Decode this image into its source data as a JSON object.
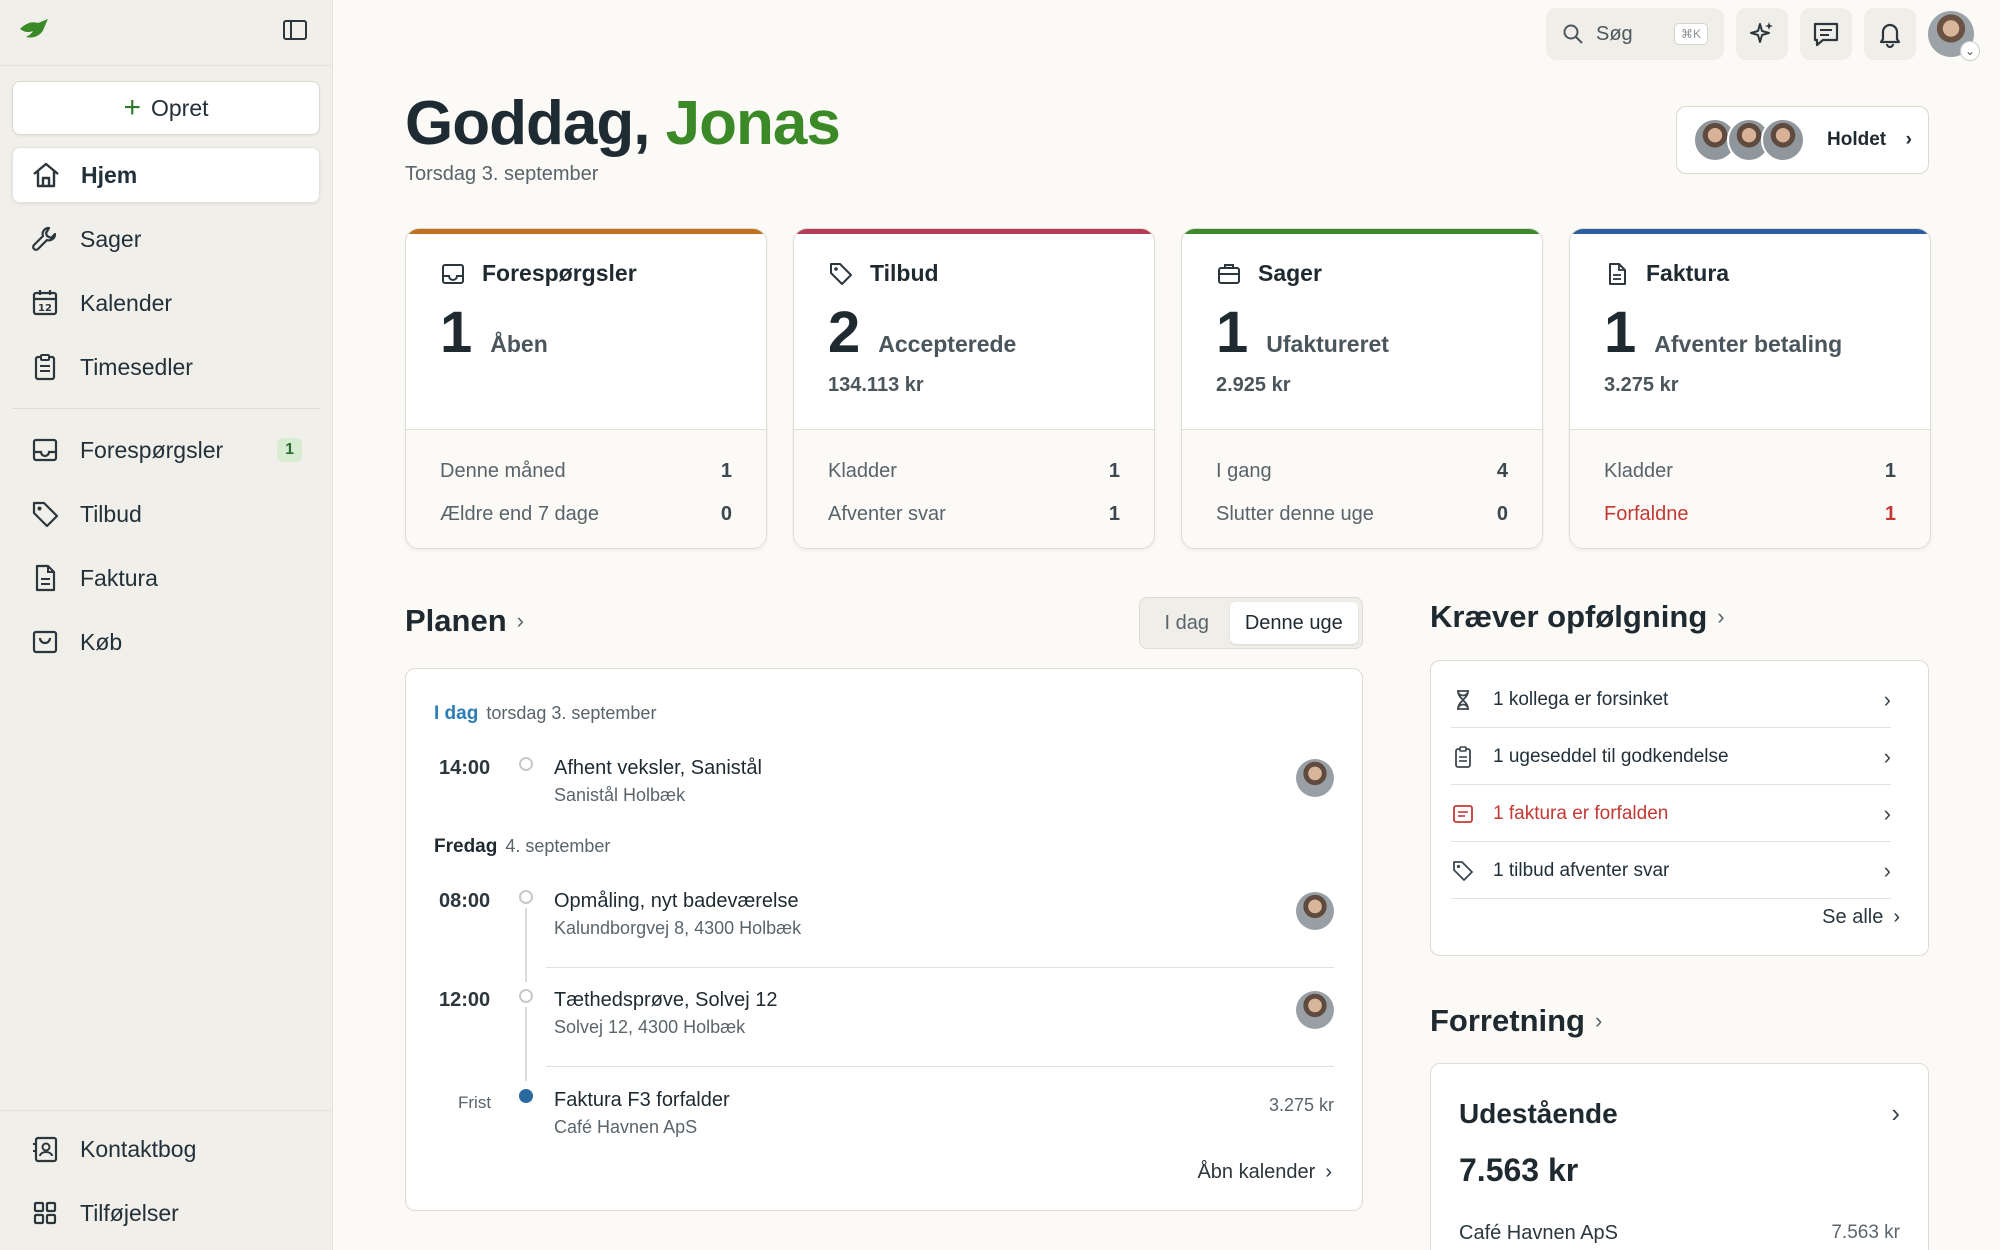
{
  "sidebar": {
    "create_label": "Opret",
    "items": [
      {
        "label": "Hjem"
      },
      {
        "label": "Sager"
      },
      {
        "label": "Kalender"
      },
      {
        "label": "Timesedler"
      },
      {
        "label": "Forespørgsler",
        "badge": "1"
      },
      {
        "label": "Tilbud"
      },
      {
        "label": "Faktura"
      },
      {
        "label": "Køb"
      }
    ],
    "bottom": [
      {
        "label": "Kontaktbog"
      },
      {
        "label": "Tilføjelser"
      }
    ]
  },
  "topbar": {
    "search_label": "Søg",
    "search_shortcut": "⌘K"
  },
  "greeting": {
    "prefix": "Goddag,",
    "name": "Jonas",
    "date": "Torsdag 3. september"
  },
  "team": {
    "label": "Holdet"
  },
  "cards": [
    {
      "title": "Forespørgsler",
      "count": "1",
      "count_label": "Åben",
      "amount": "",
      "accent": "#c0701f",
      "rows": [
        {
          "label": "Denne måned",
          "value": "1"
        },
        {
          "label": "Ældre end 7 dage",
          "value": "0"
        }
      ]
    },
    {
      "title": "Tilbud",
      "count": "2",
      "count_label": "Accepterede",
      "amount": "134.113 kr",
      "accent": "#b43a55",
      "rows": [
        {
          "label": "Kladder",
          "value": "1"
        },
        {
          "label": "Afventer svar",
          "value": "1"
        }
      ]
    },
    {
      "title": "Sager",
      "count": "1",
      "count_label": "Ufaktureret",
      "amount": "2.925 kr",
      "accent": "#3a8a2a",
      "rows": [
        {
          "label": "I gang",
          "value": "4"
        },
        {
          "label": "Slutter denne uge",
          "value": "0"
        }
      ]
    },
    {
      "title": "Faktura",
      "count": "1",
      "count_label": "Afventer betaling",
      "amount": "3.275 kr",
      "accent": "#2a5ea0",
      "rows": [
        {
          "label": "Kladder",
          "value": "1"
        },
        {
          "label": "Forfaldne",
          "value": "1",
          "alert": true
        }
      ]
    }
  ],
  "plan": {
    "title": "Planen",
    "tabs": [
      "I dag",
      "Denne uge"
    ],
    "active_tab": "Denne uge",
    "today_label": "I dag",
    "today_date": "torsdag 3. september",
    "friday_label": "Fredag",
    "friday_date": "4. september",
    "events": [
      {
        "time": "14:00",
        "title": "Afhent veksler, Sanistål",
        "address": "Sanistål Holbæk"
      },
      {
        "time": "08:00",
        "title": "Opmåling, nyt badeværelse",
        "address": "Kalundborgvej 8, 4300 Holbæk"
      },
      {
        "time": "12:00",
        "title": "Tæthedsprøve, Solvej 12",
        "address": "Solvej 12, 4300 Holbæk"
      },
      {
        "time": "Frist",
        "title": "Faktura F3 forfalder",
        "address": "Café Havnen ApS",
        "price": "3.275 kr"
      }
    ],
    "open_calendar": "Åbn kalender"
  },
  "followup": {
    "title": "Kræver opfølgning",
    "items": [
      {
        "label": "1 kollega er forsinket"
      },
      {
        "label": "1 ugeseddel til godkendelse"
      },
      {
        "label": "1 faktura er forfalden",
        "alert": true
      },
      {
        "label": "1 tilbud afventer svar"
      }
    ],
    "see_all": "Se alle"
  },
  "business": {
    "title": "Forretning",
    "card_title": "Udestående",
    "total": "7.563 kr",
    "rows": [
      {
        "label": "Café Havnen ApS",
        "value": "7.563 kr"
      }
    ]
  }
}
